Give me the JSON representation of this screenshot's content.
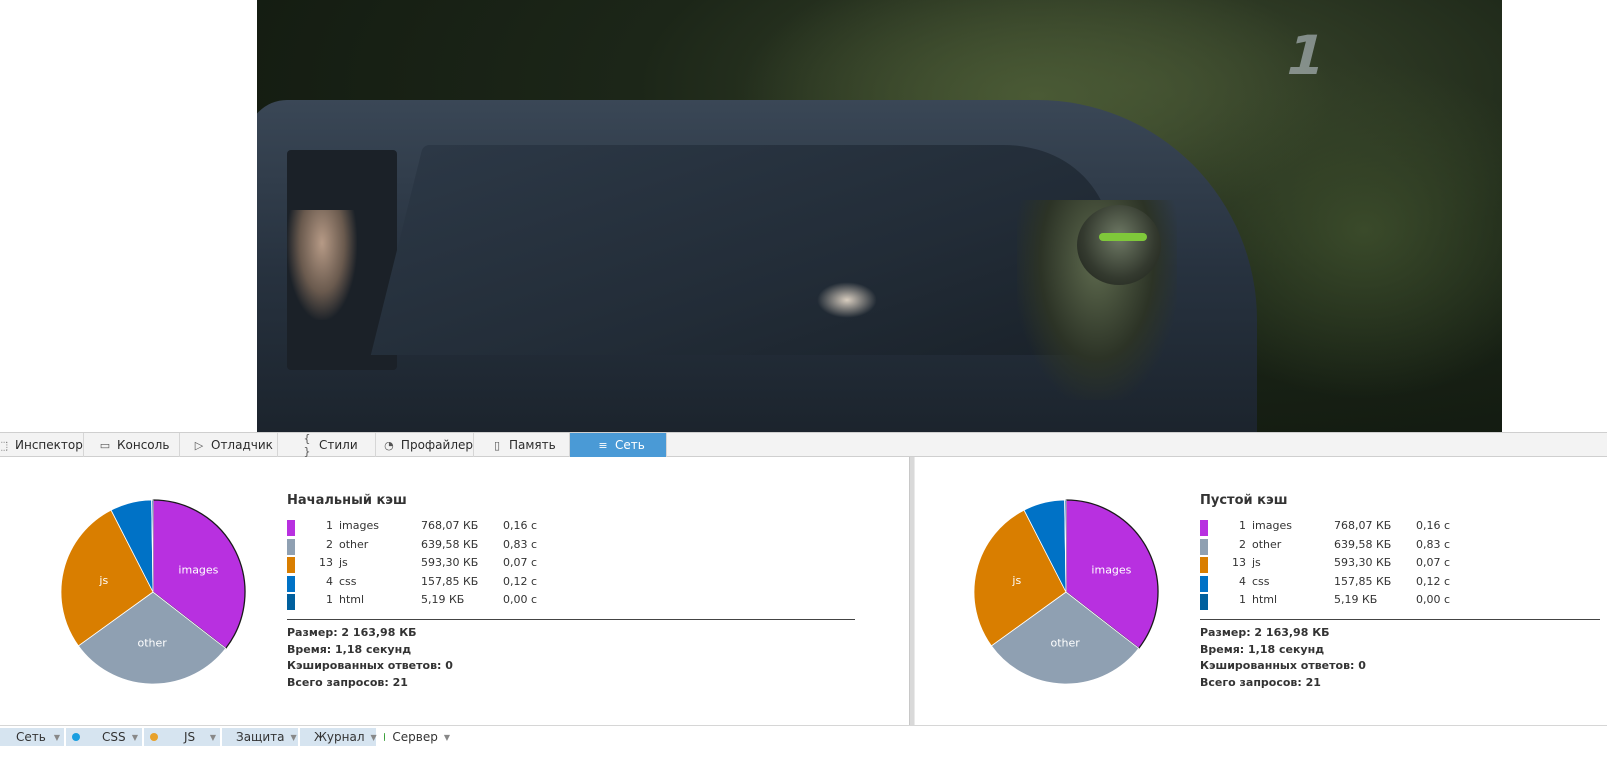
{
  "toolbar": {
    "tabs": [
      {
        "label": "Инспектор",
        "icon": "inspector-icon",
        "glyph": "⬚"
      },
      {
        "label": "Консоль",
        "icon": "console-icon",
        "glyph": "▭"
      },
      {
        "label": "Отладчик",
        "icon": "debugger-icon",
        "glyph": "▷"
      },
      {
        "label": "Стили",
        "icon": "style-editor-icon",
        "glyph": "{ }"
      },
      {
        "label": "Профайлер",
        "icon": "profiler-icon",
        "glyph": "◔"
      },
      {
        "label": "Память",
        "icon": "memory-icon",
        "glyph": "▯"
      },
      {
        "label": "Сеть",
        "icon": "network-icon",
        "glyph": "≡"
      }
    ],
    "active_tab": "Сеть"
  },
  "video": {
    "channel_logo": "1"
  },
  "colors": {
    "images": "#b830e0",
    "other": "#8fa0b2",
    "js": "#d97e00",
    "css": "#0072c6",
    "html": "#00609e",
    "active_tab": "#4a9ad6"
  },
  "panels": [
    {
      "title": "Начальный кэш",
      "rows": [
        {
          "count": "1",
          "type": "images",
          "size": "768,07 КБ",
          "time": "0,16 с"
        },
        {
          "count": "2",
          "type": "other",
          "size": "639,58 КБ",
          "time": "0,83 с"
        },
        {
          "count": "13",
          "type": "js",
          "size": "593,30 КБ",
          "time": "0,07 с"
        },
        {
          "count": "4",
          "type": "css",
          "size": "157,85 КБ",
          "time": "0,12 с"
        },
        {
          "count": "1",
          "type": "html",
          "size": "5,19 КБ",
          "time": "0,00 с"
        }
      ],
      "summary": {
        "size": "Размер: 2 163,98 КБ",
        "time": "Время: 1,18 секунд",
        "cached": "Кэшированных ответов: 0",
        "total": "Всего запросов: 21"
      },
      "pie_labels": {
        "images": "images",
        "other": "other",
        "js": "js"
      }
    },
    {
      "title": "Пустой кэш",
      "rows": [
        {
          "count": "1",
          "type": "images",
          "size": "768,07 КБ",
          "time": "0,16 с"
        },
        {
          "count": "2",
          "type": "other",
          "size": "639,58 КБ",
          "time": "0,83 с"
        },
        {
          "count": "13",
          "type": "js",
          "size": "593,30 КБ",
          "time": "0,07 с"
        },
        {
          "count": "4",
          "type": "css",
          "size": "157,85 КБ",
          "time": "0,12 с"
        },
        {
          "count": "1",
          "type": "html",
          "size": "5,19 КБ",
          "time": "0,00 с"
        }
      ],
      "summary": {
        "size": "Размер: 2 163,98 КБ",
        "time": "Время: 1,18 секунд",
        "cached": "Кэшированных ответов: 0",
        "total": "Всего запросов: 21"
      },
      "pie_labels": {
        "images": "images",
        "other": "other",
        "js": "js"
      }
    }
  ],
  "chart_data": [
    {
      "type": "pie",
      "title": "Начальный кэш",
      "categories": [
        "images",
        "other",
        "js",
        "css",
        "html"
      ],
      "values": [
        768.07,
        639.58,
        593.3,
        157.85,
        5.19
      ]
    },
    {
      "type": "pie",
      "title": "Пустой кэш",
      "categories": [
        "images",
        "other",
        "js",
        "css",
        "html"
      ],
      "values": [
        768.07,
        639.58,
        593.3,
        157.85,
        5.19
      ]
    }
  ],
  "filterbar": {
    "buttons": [
      {
        "label": "Сеть",
        "dot": "",
        "active": true
      },
      {
        "label": "CSS",
        "dot": "#1a9ee0",
        "active": true
      },
      {
        "label": "JS",
        "dot": "#e8a12a",
        "active": true
      },
      {
        "label": "Защита",
        "dot": "#e03a3a",
        "active": true
      },
      {
        "label": "Журнал",
        "dot": "#8e8e8e",
        "active": true
      },
      {
        "label": "Сервер",
        "dot": "#3aa03a",
        "active": false
      }
    ]
  }
}
